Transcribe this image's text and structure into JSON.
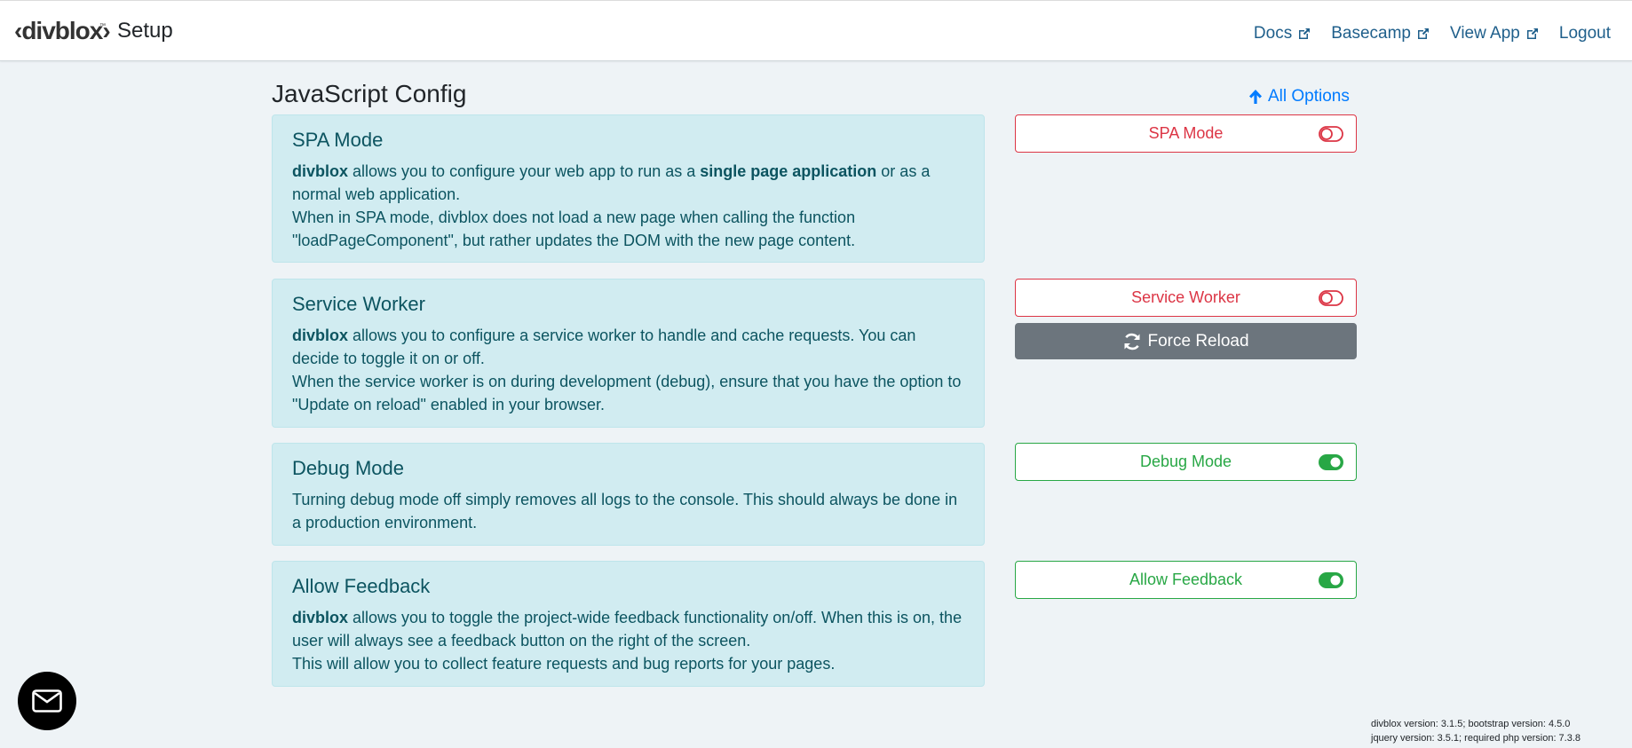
{
  "header": {
    "brand_text": "Setup",
    "logo_icon": "divblox-logo",
    "links": [
      {
        "label": "Docs",
        "icon": "external-link-icon"
      },
      {
        "label": "Basecamp",
        "icon": "external-link-icon"
      },
      {
        "label": "View App",
        "icon": "external-link-icon"
      },
      {
        "label": "Logout"
      }
    ]
  },
  "page": {
    "title": "JavaScript Config",
    "all_options_label": "All Options",
    "all_options_icon": "arrow-up-icon"
  },
  "sections": [
    {
      "title": "SPA Mode",
      "p1_pre": "divblox",
      "p1_mid": " allows you to configure your web app to run as a ",
      "p1_bold2": "single page application",
      "p1_post": " or as a normal web application.",
      "p2": "When in SPA mode, divblox does not load a new page when calling the function \"loadPageComponent\", but rather updates the DOM with the new page content.",
      "toggle_label": "SPA Mode",
      "toggle_state": "off"
    },
    {
      "title": "Service Worker",
      "p1_pre": "divblox",
      "p1_post": " allows you to configure a service worker to handle and cache requests. You can decide to toggle it on or off.",
      "p2": "When the service worker is on during development (debug), ensure that you have the option to \"Update on reload\" enabled in your browser.",
      "toggle_label": "Service Worker",
      "toggle_state": "off",
      "force_reload_label": "Force Reload",
      "force_reload_icon": "sync-icon"
    },
    {
      "title": "Debug Mode",
      "p1": "Turning debug mode off simply removes all logs to the console. This should always be done in a production environment.",
      "toggle_label": "Debug Mode",
      "toggle_state": "on"
    },
    {
      "title": "Allow Feedback",
      "p1_pre": "divblox",
      "p1_post": " allows you to toggle the project-wide feedback functionality on/off. When this is on, the user will always see a feedback button on the right of the screen.",
      "p2": "This will allow you to collect feature requests and bug reports for your pages.",
      "toggle_label": "Allow Feedback",
      "toggle_state": "on"
    }
  ],
  "feedback_button_icon": "mail-icon",
  "footer": {
    "line1": "divblox version: 3.1.5; bootstrap version: 4.5.0",
    "line2": "jquery version: 3.5.1; required php version: 7.3.8"
  },
  "colors": {
    "off": "#dc3545",
    "on": "#28a745",
    "card_bg": "#d1ecf1",
    "card_text": "#0c5460",
    "link": "#1f5f8b",
    "primary": "#007bff",
    "secondary": "#6c757d"
  }
}
